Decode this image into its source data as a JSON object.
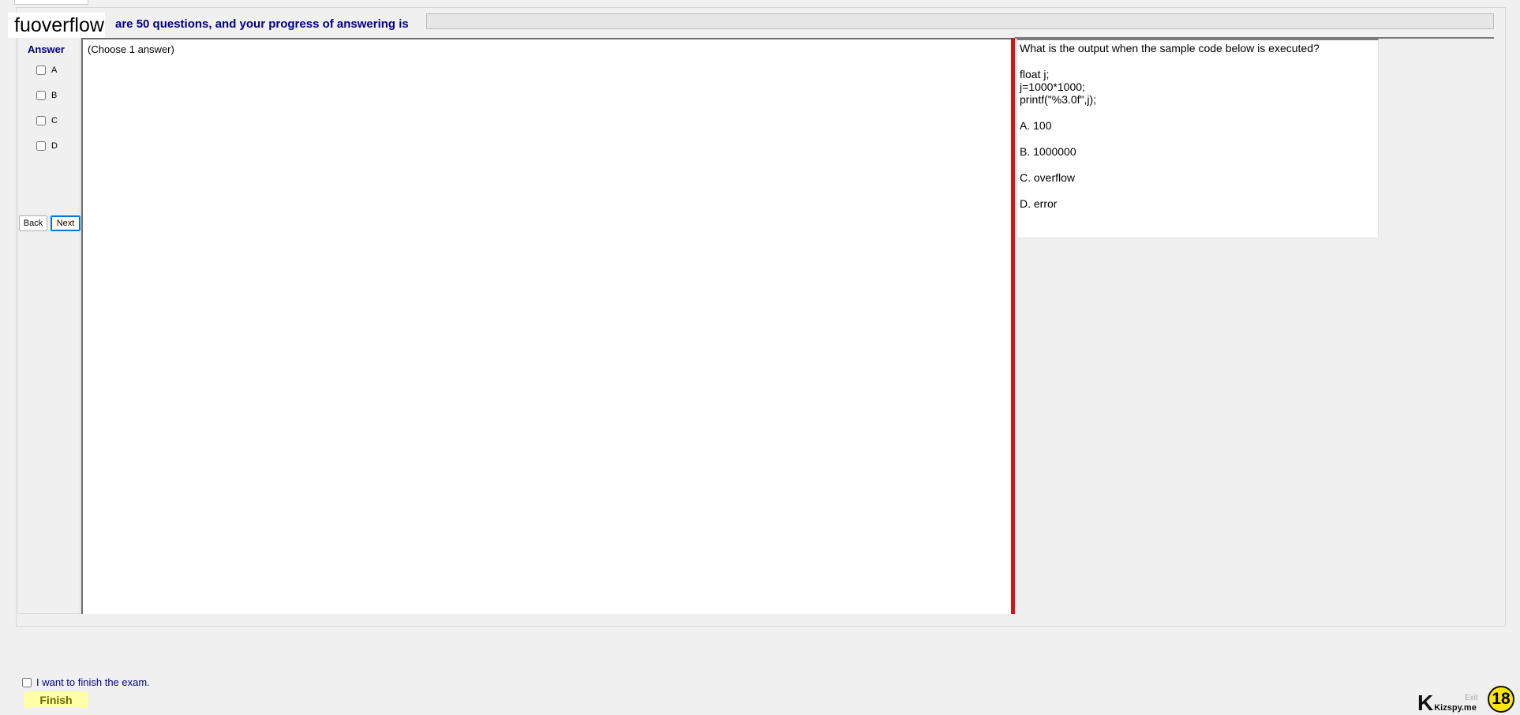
{
  "header": {
    "watermark": "fuoverflow",
    "progress_text": "are 50 questions, and your progress of answering is",
    "progress_fraction": 0
  },
  "answer_panel": {
    "title": "Answer",
    "options": [
      "A",
      "B",
      "C",
      "D"
    ],
    "back_label": "Back",
    "next_label": "Next"
  },
  "question": {
    "choose_hint": "(Choose 1 answer)",
    "prompt": "What is the output when the sample code below is executed?",
    "code": [
      "float j;",
      "j=1000*1000;",
      "printf(\"%3.0f\",j);"
    ],
    "choices": [
      "A.  100",
      "B.  1000000",
      "C.  overflow",
      "D.  error"
    ]
  },
  "footer": {
    "finish_check_label": "I want to finish the exam.",
    "finish_label": "Finish",
    "brand_name": "Kizspy.me",
    "exit_label": "Exit",
    "counter": "18"
  }
}
